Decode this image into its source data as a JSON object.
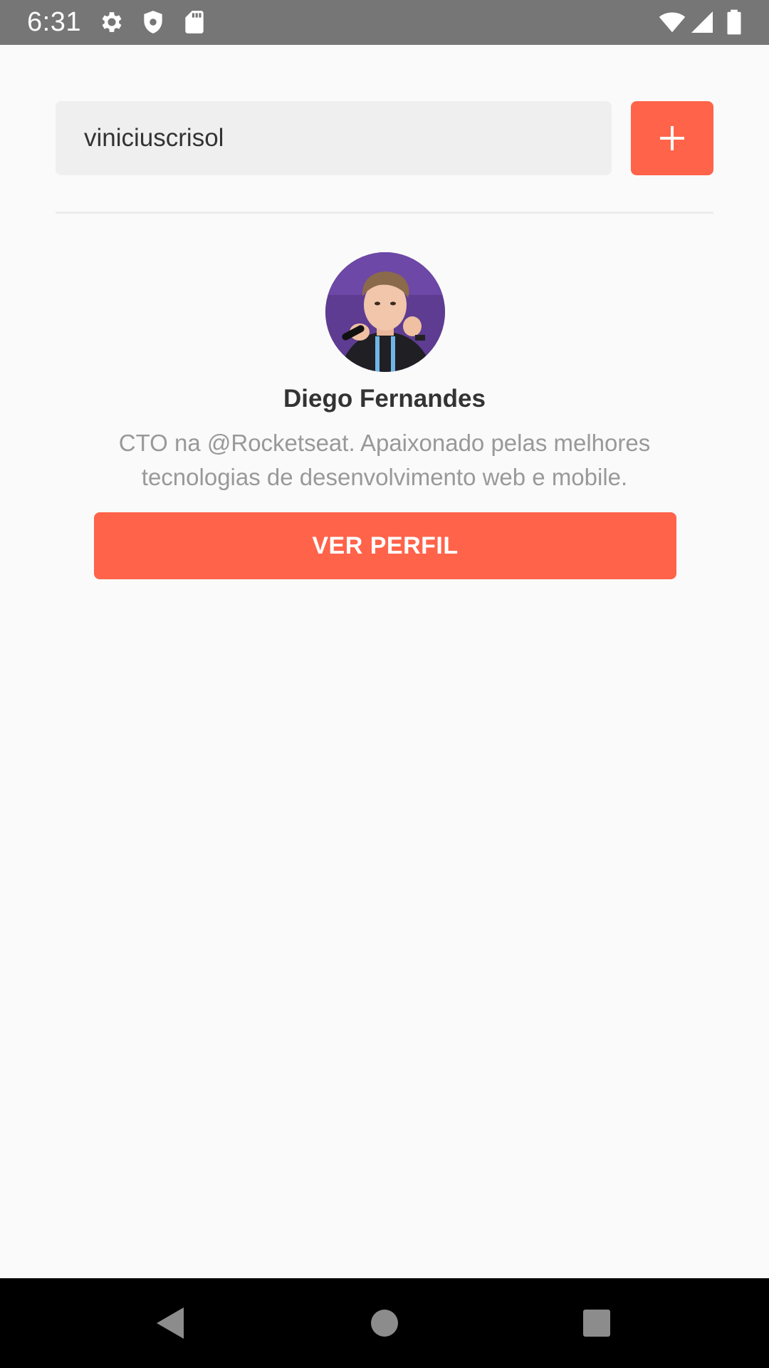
{
  "status_bar": {
    "time": "6:31",
    "left_icons": [
      "gear-icon",
      "shield-icon",
      "sd-card-icon"
    ],
    "right_icons": [
      "wifi-icon",
      "cell-signal-icon",
      "battery-icon"
    ],
    "background": "#767676"
  },
  "search": {
    "value": "viniciuscrisol",
    "placeholder": ""
  },
  "add_button": {
    "icon": "plus-icon",
    "color": "#ff634a"
  },
  "profile": {
    "name": "Diego Fernandes",
    "bio": "CTO na @Rocketseat. Apaixonado pelas melhores tecnologias de desenvolvimento web e mobile.",
    "button_label": "VER PERFIL",
    "avatar": "avatar-photo"
  },
  "nav_bar": {
    "buttons": [
      "back-icon",
      "home-icon",
      "recents-icon"
    ]
  },
  "colors": {
    "accent": "#ff634a",
    "background": "#fafafa",
    "input_bg": "#efefef",
    "name_text": "#333333",
    "bio_text": "#999999"
  }
}
